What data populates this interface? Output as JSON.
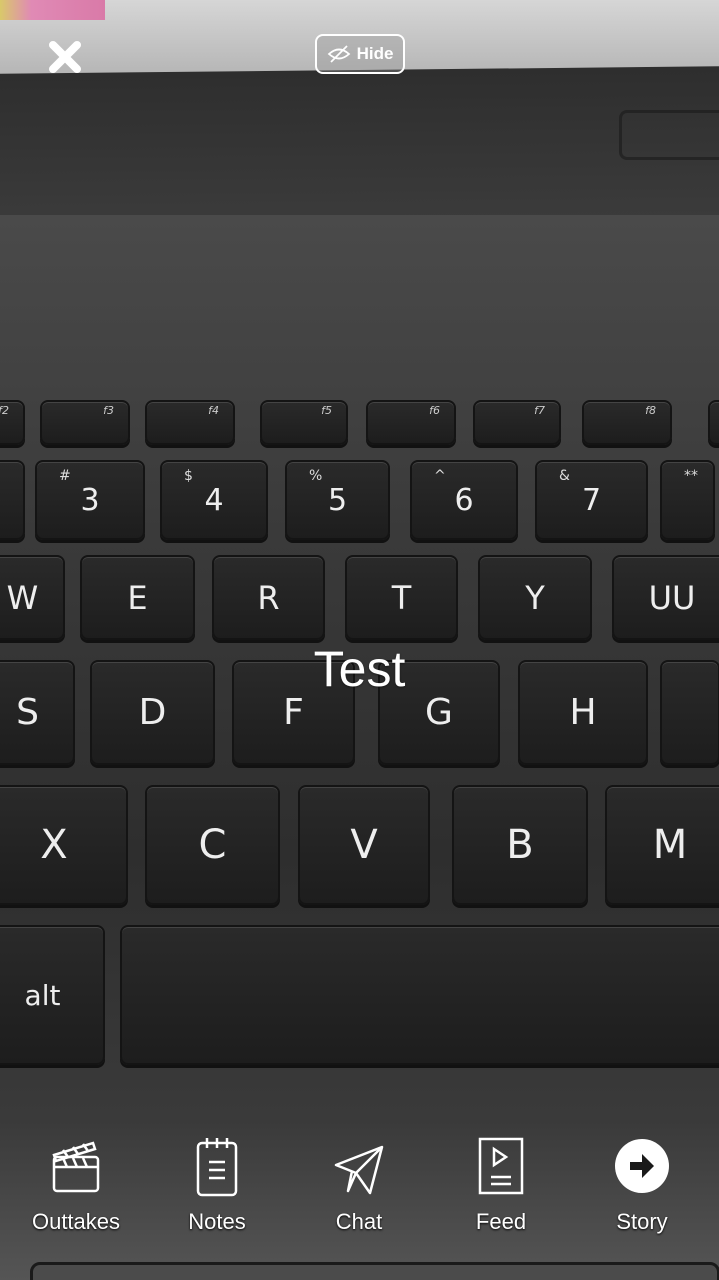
{
  "top_bar": {
    "close_icon": "close-icon",
    "hide_label": "Hide",
    "hide_icon": "eye-slash-icon"
  },
  "caption": "Test",
  "keyboard_photo": {
    "function_row": [
      "f2",
      "f3",
      "f4",
      "f5",
      "f6",
      "f7",
      "f8"
    ],
    "number_row": [
      {
        "main": "",
        "sub": ""
      },
      {
        "main": "3",
        "sub": "#"
      },
      {
        "main": "4",
        "sub": "$"
      },
      {
        "main": "5",
        "sub": "%"
      },
      {
        "main": "6",
        "sub": "^"
      },
      {
        "main": "7",
        "sub": "&"
      },
      {
        "main": "",
        "sub": "**"
      }
    ],
    "qwerty_row": [
      "W",
      "E",
      "R",
      "T",
      "Y",
      "UU"
    ],
    "home_row": [
      "S",
      "D",
      "F",
      "G",
      "H",
      ""
    ],
    "bottom_row": [
      "X",
      "C",
      "V",
      "B",
      "M"
    ],
    "modifier": "alt"
  },
  "nav": [
    {
      "label": "Outtakes",
      "icon": "clapperboard-icon"
    },
    {
      "label": "Notes",
      "icon": "notepad-icon"
    },
    {
      "label": "Chat",
      "icon": "paper-plane-icon"
    },
    {
      "label": "Feed",
      "icon": "play-document-icon"
    },
    {
      "label": "Story",
      "icon": "arrow-circle-icon"
    }
  ]
}
